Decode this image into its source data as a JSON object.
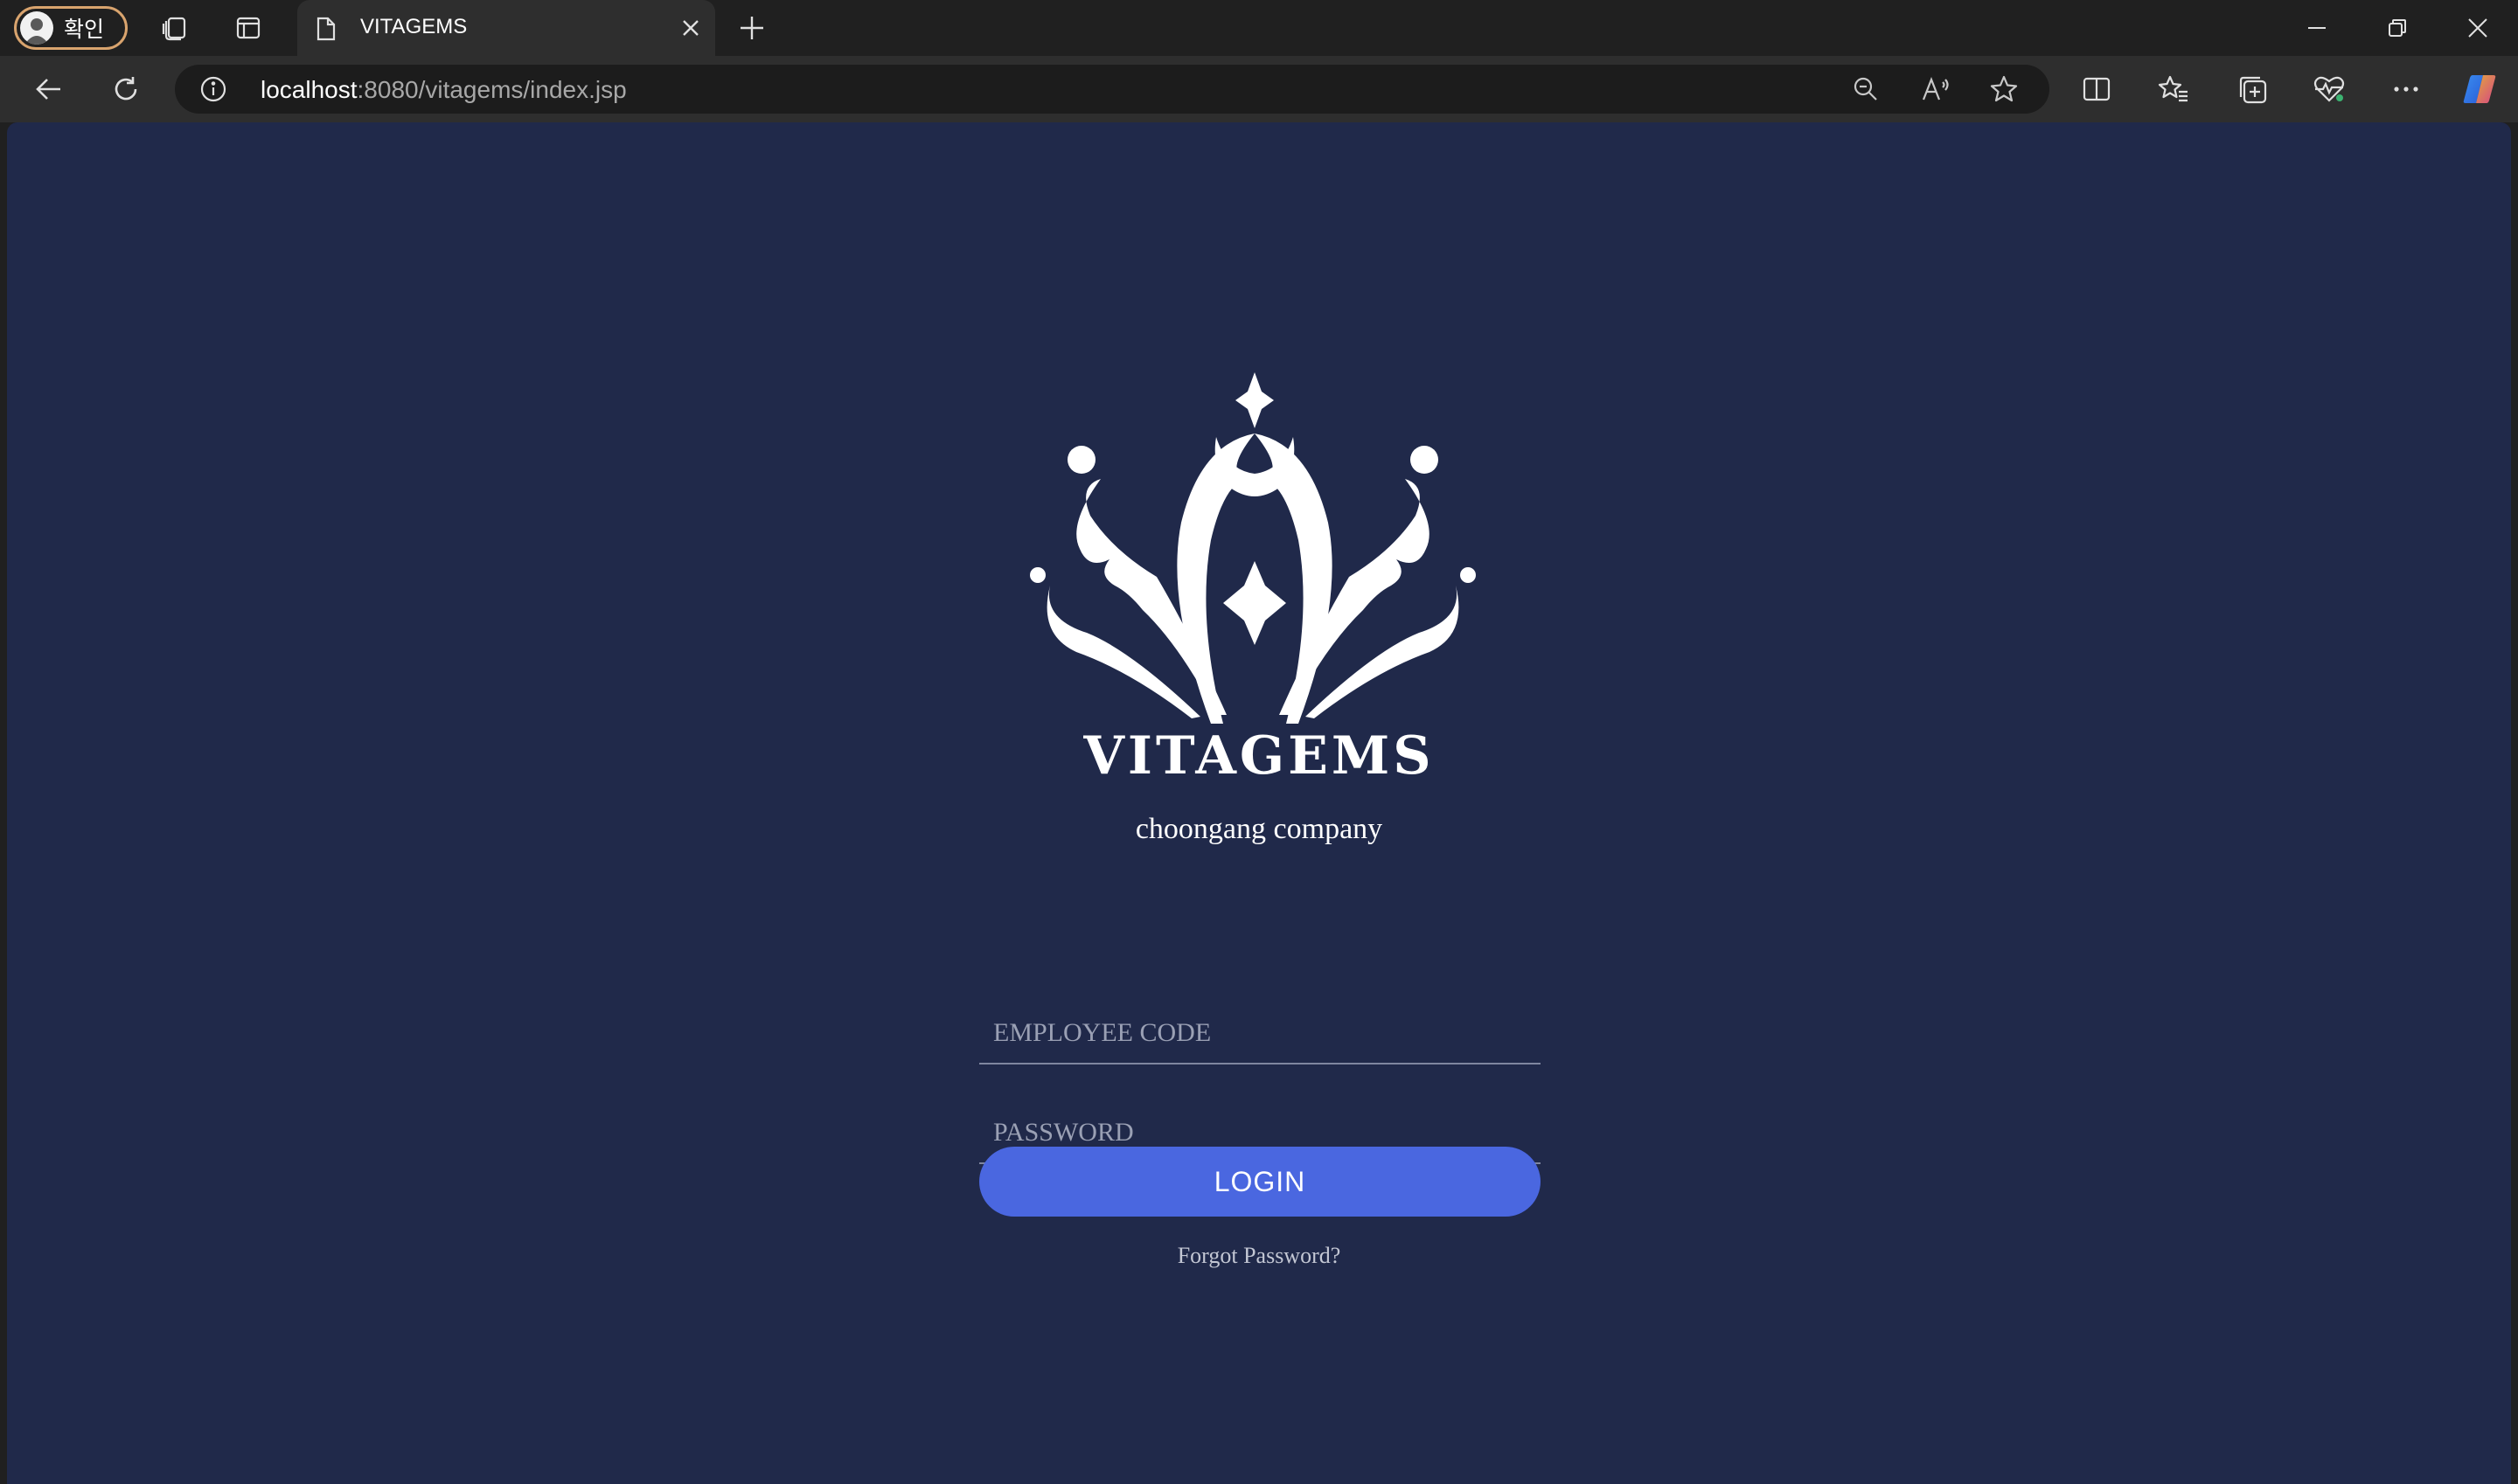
{
  "browser": {
    "profile_label": "확인",
    "tab_title": "VITAGEMS",
    "url_host": "localhost",
    "url_rest": ":8080/vitagems/index.jsp"
  },
  "page": {
    "brand": "VITAGEMS",
    "company": "choongang company",
    "employee_code_placeholder": "EMPLOYEE CODE",
    "password_placeholder": "PASSWORD",
    "login_label": "LOGIN",
    "forgot_label": "Forgot Password?",
    "colors": {
      "background": "#20294a",
      "button": "#4a67e0"
    }
  },
  "icons": {
    "profile": "avatar",
    "workspaces": "workspaces-icon",
    "vertical_tabs": "tab-actions-icon",
    "tab_favicon": "page-icon",
    "tab_close": "close-icon",
    "new_tab": "plus-icon",
    "back": "arrow-left-icon",
    "refresh": "refresh-icon",
    "site_info": "info-icon",
    "zoom": "zoom-out-icon",
    "read_aloud": "read-aloud-icon",
    "favorite": "star-icon",
    "split": "split-screen-icon",
    "favorites": "favorites-icon",
    "collections": "collections-icon",
    "performance": "heart-pulse-icon",
    "more": "more-icon",
    "copilot": "copilot-icon",
    "logo": "vitagems-logo"
  }
}
